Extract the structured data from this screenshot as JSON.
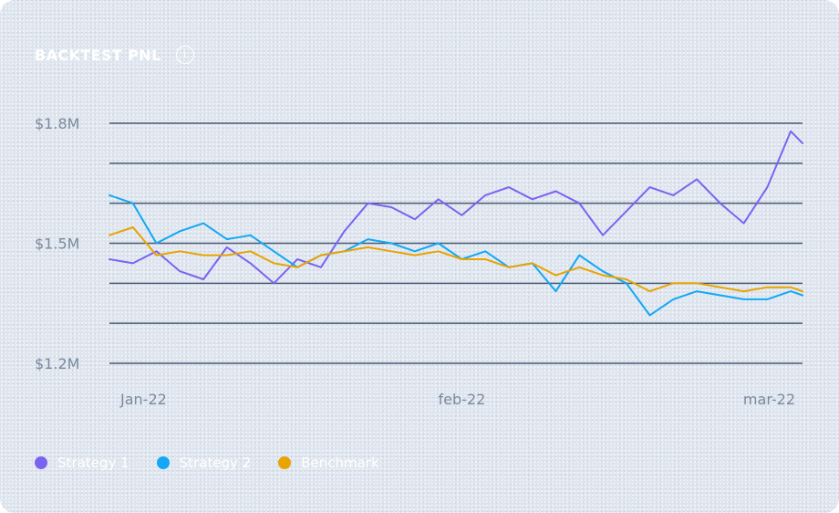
{
  "header": {
    "title": "BACKTEST PNL",
    "info_glyph": "i"
  },
  "chart_data": {
    "type": "line",
    "title": "BACKTEST PNL",
    "xlabel": "",
    "ylabel": "",
    "y_tick_labels": [
      "$1.8M",
      "$1.5M",
      "$1.2M"
    ],
    "y_ticks": [
      1.8,
      1.5,
      1.2
    ],
    "ylim": [
      1.2,
      1.8
    ],
    "y_unit": "$M",
    "x_tick_labels": [
      "Jan-22",
      "feb-22",
      "mar-22"
    ],
    "x_ticks": [
      1,
      31,
      59
    ],
    "xlim": [
      1,
      60
    ],
    "grid": true,
    "legend_position": "bottom-left",
    "x": [
      1,
      3,
      5,
      7,
      9,
      11,
      13,
      15,
      17,
      19,
      21,
      23,
      25,
      27,
      29,
      31,
      33,
      35,
      37,
      39,
      41,
      43,
      45,
      47,
      49,
      51,
      53,
      55,
      57,
      59,
      60
    ],
    "series": [
      {
        "name": "Strategy 1",
        "color": "#7b63f2",
        "values": [
          1.46,
          1.45,
          1.48,
          1.43,
          1.41,
          1.49,
          1.45,
          1.4,
          1.46,
          1.44,
          1.53,
          1.6,
          1.59,
          1.56,
          1.61,
          1.57,
          1.62,
          1.64,
          1.61,
          1.63,
          1.6,
          1.52,
          1.58,
          1.64,
          1.62,
          1.66,
          1.6,
          1.55,
          1.64,
          1.78,
          1.75
        ]
      },
      {
        "name": "Strategy 2",
        "color": "#12a8f5",
        "values": [
          1.62,
          1.6,
          1.5,
          1.53,
          1.55,
          1.51,
          1.52,
          1.48,
          1.44,
          1.47,
          1.48,
          1.51,
          1.5,
          1.48,
          1.5,
          1.46,
          1.48,
          1.44,
          1.45,
          1.38,
          1.47,
          1.43,
          1.4,
          1.32,
          1.36,
          1.38,
          1.37,
          1.36,
          1.36,
          1.38,
          1.37
        ]
      },
      {
        "name": "Benchmark",
        "color": "#e8a400",
        "values": [
          1.52,
          1.54,
          1.47,
          1.48,
          1.47,
          1.47,
          1.48,
          1.45,
          1.44,
          1.47,
          1.48,
          1.49,
          1.48,
          1.47,
          1.48,
          1.46,
          1.46,
          1.44,
          1.45,
          1.42,
          1.44,
          1.42,
          1.41,
          1.38,
          1.4,
          1.4,
          1.39,
          1.38,
          1.39,
          1.39,
          1.38
        ]
      }
    ]
  },
  "colors": {
    "grid": "#4a5a73",
    "tick_text": "#7a8a9e",
    "title": "#ffffff"
  }
}
